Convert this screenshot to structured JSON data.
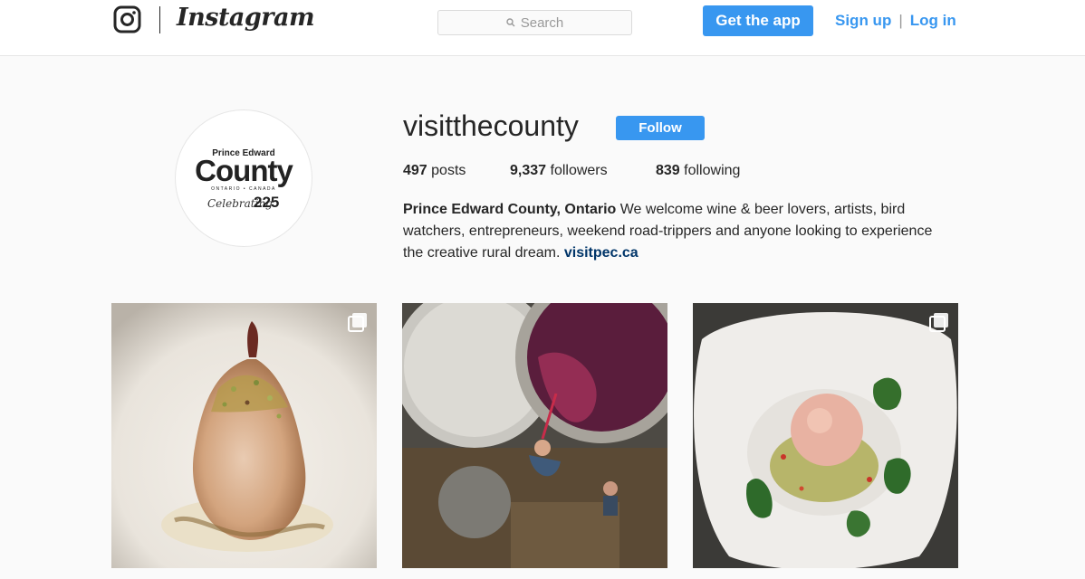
{
  "header": {
    "brand": "Instagram",
    "search_placeholder": "Search",
    "get_app_label": "Get the app",
    "signup_label": "Sign up",
    "separator": "|",
    "login_label": "Log in"
  },
  "profile": {
    "username": "visitthecounty",
    "follow_label": "Follow",
    "avatar_logo": {
      "pre": "Prince Edward",
      "main": "County",
      "sub": "ONTARIO • CANADA",
      "celebrating": "Celebrating",
      "years": "225"
    },
    "stats": {
      "posts_count": "497",
      "posts_label": "posts",
      "followers_count": "9,337",
      "followers_label": "followers",
      "following_count": "839",
      "following_label": "following"
    },
    "bio": {
      "name": "Prince Edward County, Ontario",
      "text": " We welcome wine & beer lovers, artists, bird watchers, entrepreneurs, weekend road-trippers and anyone looking to experience the creative rural dream. ",
      "link": "visitpec.ca"
    }
  },
  "posts": [
    {
      "subject": "poached-pear-dessert",
      "multi": true
    },
    {
      "subject": "winery-tank-overhead",
      "multi": false
    },
    {
      "subject": "plated-dish-with-cilantro",
      "multi": true
    }
  ],
  "colors": {
    "accent": "#3897f0",
    "link_dark": "#003569",
    "text": "#262626",
    "background": "#fafafa"
  }
}
